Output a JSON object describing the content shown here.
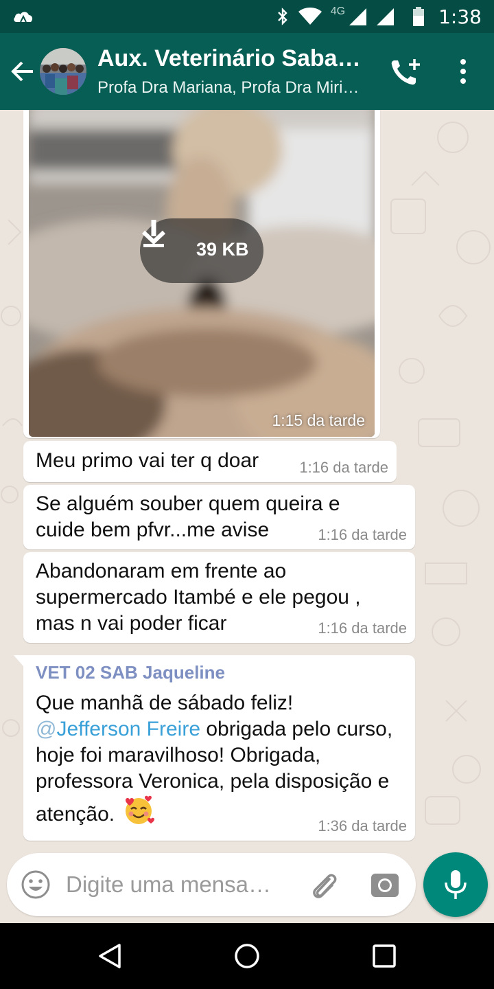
{
  "status_bar": {
    "time": "1:38",
    "network_label": "4G"
  },
  "header": {
    "title": "Aux. Veterinário Sabad…",
    "subtitle": "Profa Dra Mariana, Profa Dra Miri…"
  },
  "messages": {
    "image": {
      "download_size": "39 KB",
      "time": "1:15 da tarde"
    },
    "m1": {
      "text": "Meu primo vai ter q doar",
      "time": "1:16 da tarde"
    },
    "m2": {
      "text": "Se alguém souber quem queira e cuide bem pfvr...me avise",
      "time": "1:16 da tarde"
    },
    "m3": {
      "text": "Abandonaram em frente ao supermercado Itambé e ele pegou , mas n vai poder ficar",
      "time": "1:16 da tarde"
    },
    "m4": {
      "sender": "VET 02 SAB Jaqueline",
      "line1": "Que manhã de sábado feliz!",
      "mention_at": "@",
      "mention_name": "Jefferson Freire",
      "after_mention": " obrigada pelo curso, hoje foi maravilhoso! Obrigada, professora Veronica, pela disposição e atenção. ",
      "time": "1:36 da tarde"
    }
  },
  "composer": {
    "placeholder": "Digite uma mensa…"
  },
  "colors": {
    "header": "#075e54",
    "status_bar": "#054d44",
    "chat_bg": "#ece5dd",
    "mic_button": "#00897b",
    "sender_name": "#7e8fc2",
    "mention": "#3aa0d8"
  }
}
